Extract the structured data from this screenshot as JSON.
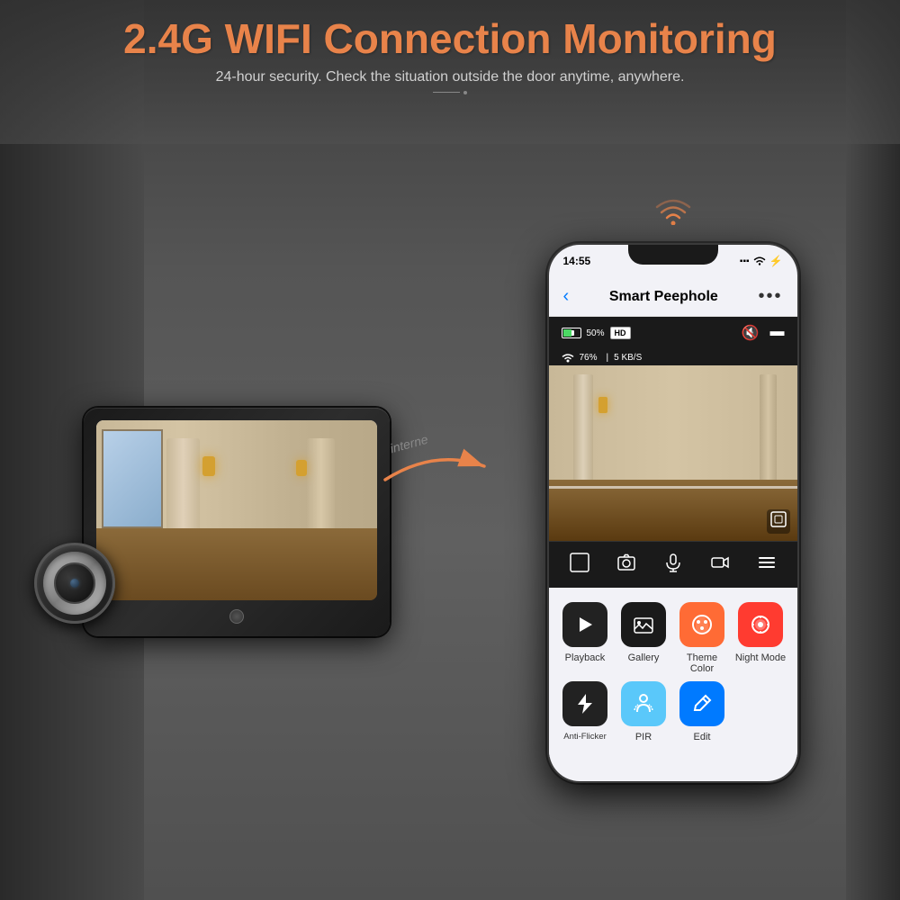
{
  "header": {
    "main_title": "2.4G WIFI Connection Monitoring",
    "sub_title": "24-hour security. Check the situation outside the door anytime, anywhere."
  },
  "arrow": {
    "label": "interne"
  },
  "phone": {
    "time": "14:55",
    "status": {
      "signal_bars": "|||",
      "wifi": "▼",
      "battery": "⚡"
    },
    "app_name": "Smart Peephole",
    "back_icon": "‹",
    "more_icon": "•••",
    "battery_percent": "50%",
    "hd_badge": "HD",
    "wifi_percent": "76%",
    "data_speed": "5 KB/S",
    "toolbar": {
      "mute_icon": "🔇",
      "screen_icon": "⬛"
    },
    "controls": {
      "fullscreen": "[ ]",
      "screenshot": "📷",
      "mic": "🎤",
      "record": "⏺",
      "menu": "≡"
    },
    "functions": [
      {
        "id": "playback",
        "label": "Playback",
        "icon": "▶",
        "color": "dark"
      },
      {
        "id": "gallery",
        "label": "Gallery",
        "icon": "🖼",
        "color": "dark-gallery"
      },
      {
        "id": "theme_color",
        "label": "Theme Color",
        "icon": "🎨",
        "color": "orange"
      },
      {
        "id": "night_mode",
        "label": "Night Mode",
        "icon": "🌙",
        "color": "red"
      },
      {
        "id": "anti_flicker",
        "label": "Anti-Flicker",
        "icon": "⚡",
        "color": "dark"
      },
      {
        "id": "pir",
        "label": "PIR",
        "icon": "👤",
        "color": "teal"
      },
      {
        "id": "edit",
        "label": "Edit",
        "icon": "✏",
        "color": "blue"
      }
    ]
  }
}
